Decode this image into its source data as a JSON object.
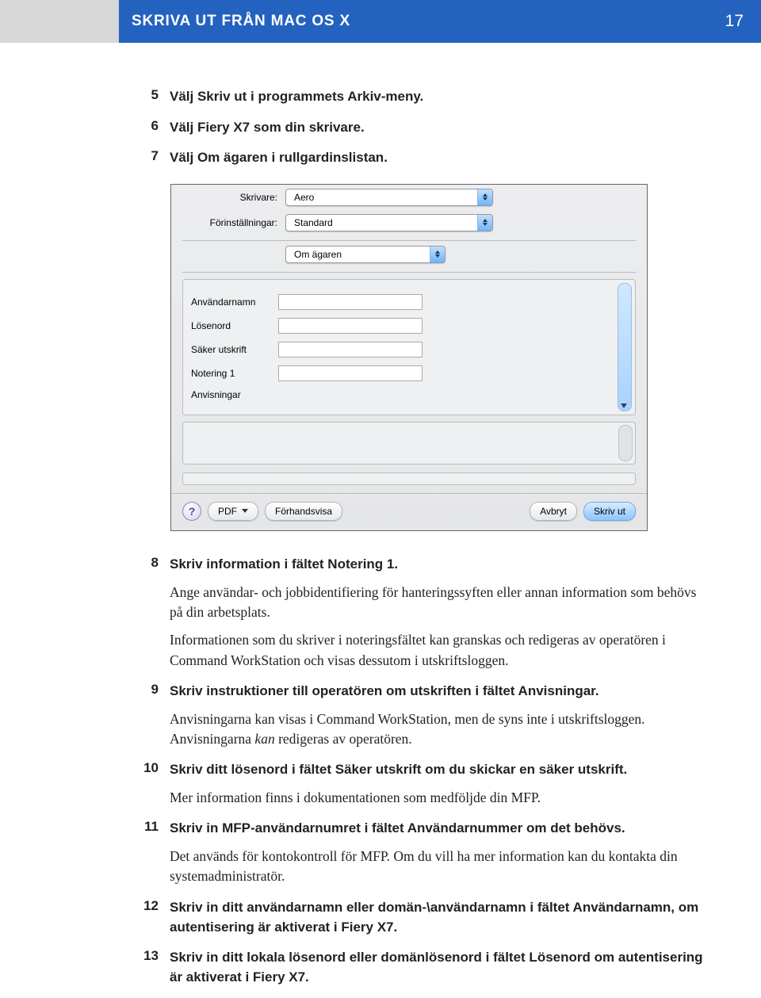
{
  "header": {
    "title": "SKRIVA UT FRÅN MAC OS X",
    "page": "17"
  },
  "steps": {
    "s5": {
      "num": "5",
      "title": "Välj Skriv ut i programmets Arkiv-meny."
    },
    "s6": {
      "num": "6",
      "title": "Välj Fiery X7 som din skrivare."
    },
    "s7": {
      "num": "7",
      "title": "Välj Om ägaren i rullgardinslistan."
    },
    "s8": {
      "num": "8",
      "title": "Skriv information i fältet Notering 1.",
      "p1": "Ange användar- och jobbidentifiering för hanteringssyften eller annan information som behövs på din arbetsplats.",
      "p2": "Informationen som du skriver i noteringsfältet kan granskas och redigeras av operatören i Command WorkStation och visas dessutom i utskriftsloggen."
    },
    "s9": {
      "num": "9",
      "title": "Skriv instruktioner till operatören om utskriften i fältet Anvisningar.",
      "p1a": "Anvisningarna kan visas i Command WorkStation, men de syns inte i utskriftsloggen. Anvisningarna ",
      "p1b": "kan",
      "p1c": " redigeras av operatören."
    },
    "s10": {
      "num": "10",
      "title": "Skriv ditt lösenord i fältet Säker utskrift om du skickar en säker utskrift.",
      "p1": "Mer information finns i dokumentationen som medföljde din MFP."
    },
    "s11": {
      "num": "11",
      "title": "Skriv in MFP-användarnumret i fältet Användarnummer om det behövs.",
      "p1": "Det används för kontokontroll för MFP. Om du vill ha mer information kan du kontakta din systemadministratör."
    },
    "s12": {
      "num": "12",
      "title": "Skriv in ditt användarnamn eller domän-\\användarnamn i fältet Användarnamn, om autentisering är aktiverat i Fiery X7."
    },
    "s13": {
      "num": "13",
      "title": "Skriv in ditt lokala lösenord eller domänlösenord i fältet Lösenord om autentisering är aktiverat i Fiery X7."
    }
  },
  "dialog": {
    "skrivare_label": "Skrivare:",
    "skrivare_value": "Aero",
    "forinst_label": "Förinställningar:",
    "forinst_value": "Standard",
    "section_value": "Om ägaren",
    "fields": {
      "anvandarnamn": "Användarnamn",
      "losenord": "Lösenord",
      "saker": "Säker utskrift",
      "notering": "Notering 1",
      "anvisningar": "Anvisningar"
    },
    "footer": {
      "help": "?",
      "pdf": "PDF",
      "preview": "Förhandsvisa",
      "cancel": "Avbryt",
      "print": "Skriv ut"
    }
  }
}
